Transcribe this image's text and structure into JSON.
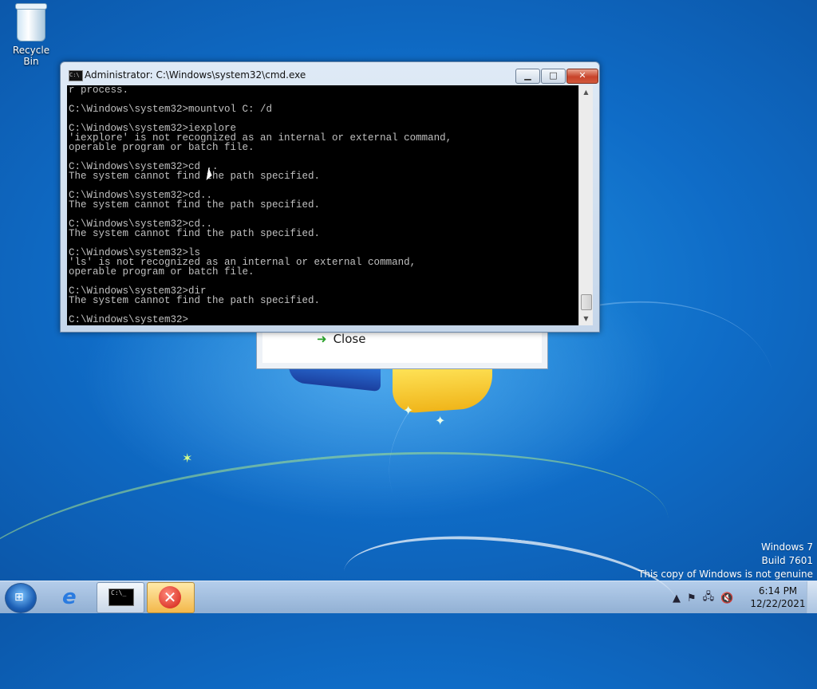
{
  "desktop": {
    "recycle_bin_label": "Recycle Bin",
    "watermark": {
      "line1": "Windows 7",
      "line2": "Build 7601",
      "line3": "This copy of Windows is not genuine"
    }
  },
  "background_dialog": {
    "close_label": "Close"
  },
  "cmd_window": {
    "title": "Administrator: C:\\Windows\\system32\\cmd.exe",
    "console_text": "r process.\n\nC:\\Windows\\system32>mountvol C: /d\n\nC:\\Windows\\system32>iexplore\n'iexplore' is not recognized as an internal or external command,\noperable program or batch file.\n\nC:\\Windows\\system32>cd ..\nThe system cannot find the path specified.\n\nC:\\Windows\\system32>cd..\nThe system cannot find the path specified.\n\nC:\\Windows\\system32>cd..\nThe system cannot find the path specified.\n\nC:\\Windows\\system32>ls\n'ls' is not recognized as an internal or external command,\noperable program or batch file.\n\nC:\\Windows\\system32>dir\nThe system cannot find the path specified.\n\nC:\\Windows\\system32>",
    "minimize_glyph": "▁",
    "maximize_glyph": "□",
    "close_glyph": "✕"
  },
  "taskbar": {
    "clock_time": "6:14 PM",
    "clock_date": "12/22/2021",
    "icons": [
      "start-orb-icon",
      "internet-explorer-icon",
      "cmd-icon",
      "error-icon",
      "show-hidden-icons-icon",
      "action-center-flag-icon",
      "network-icon",
      "volume-muted-icon"
    ]
  }
}
